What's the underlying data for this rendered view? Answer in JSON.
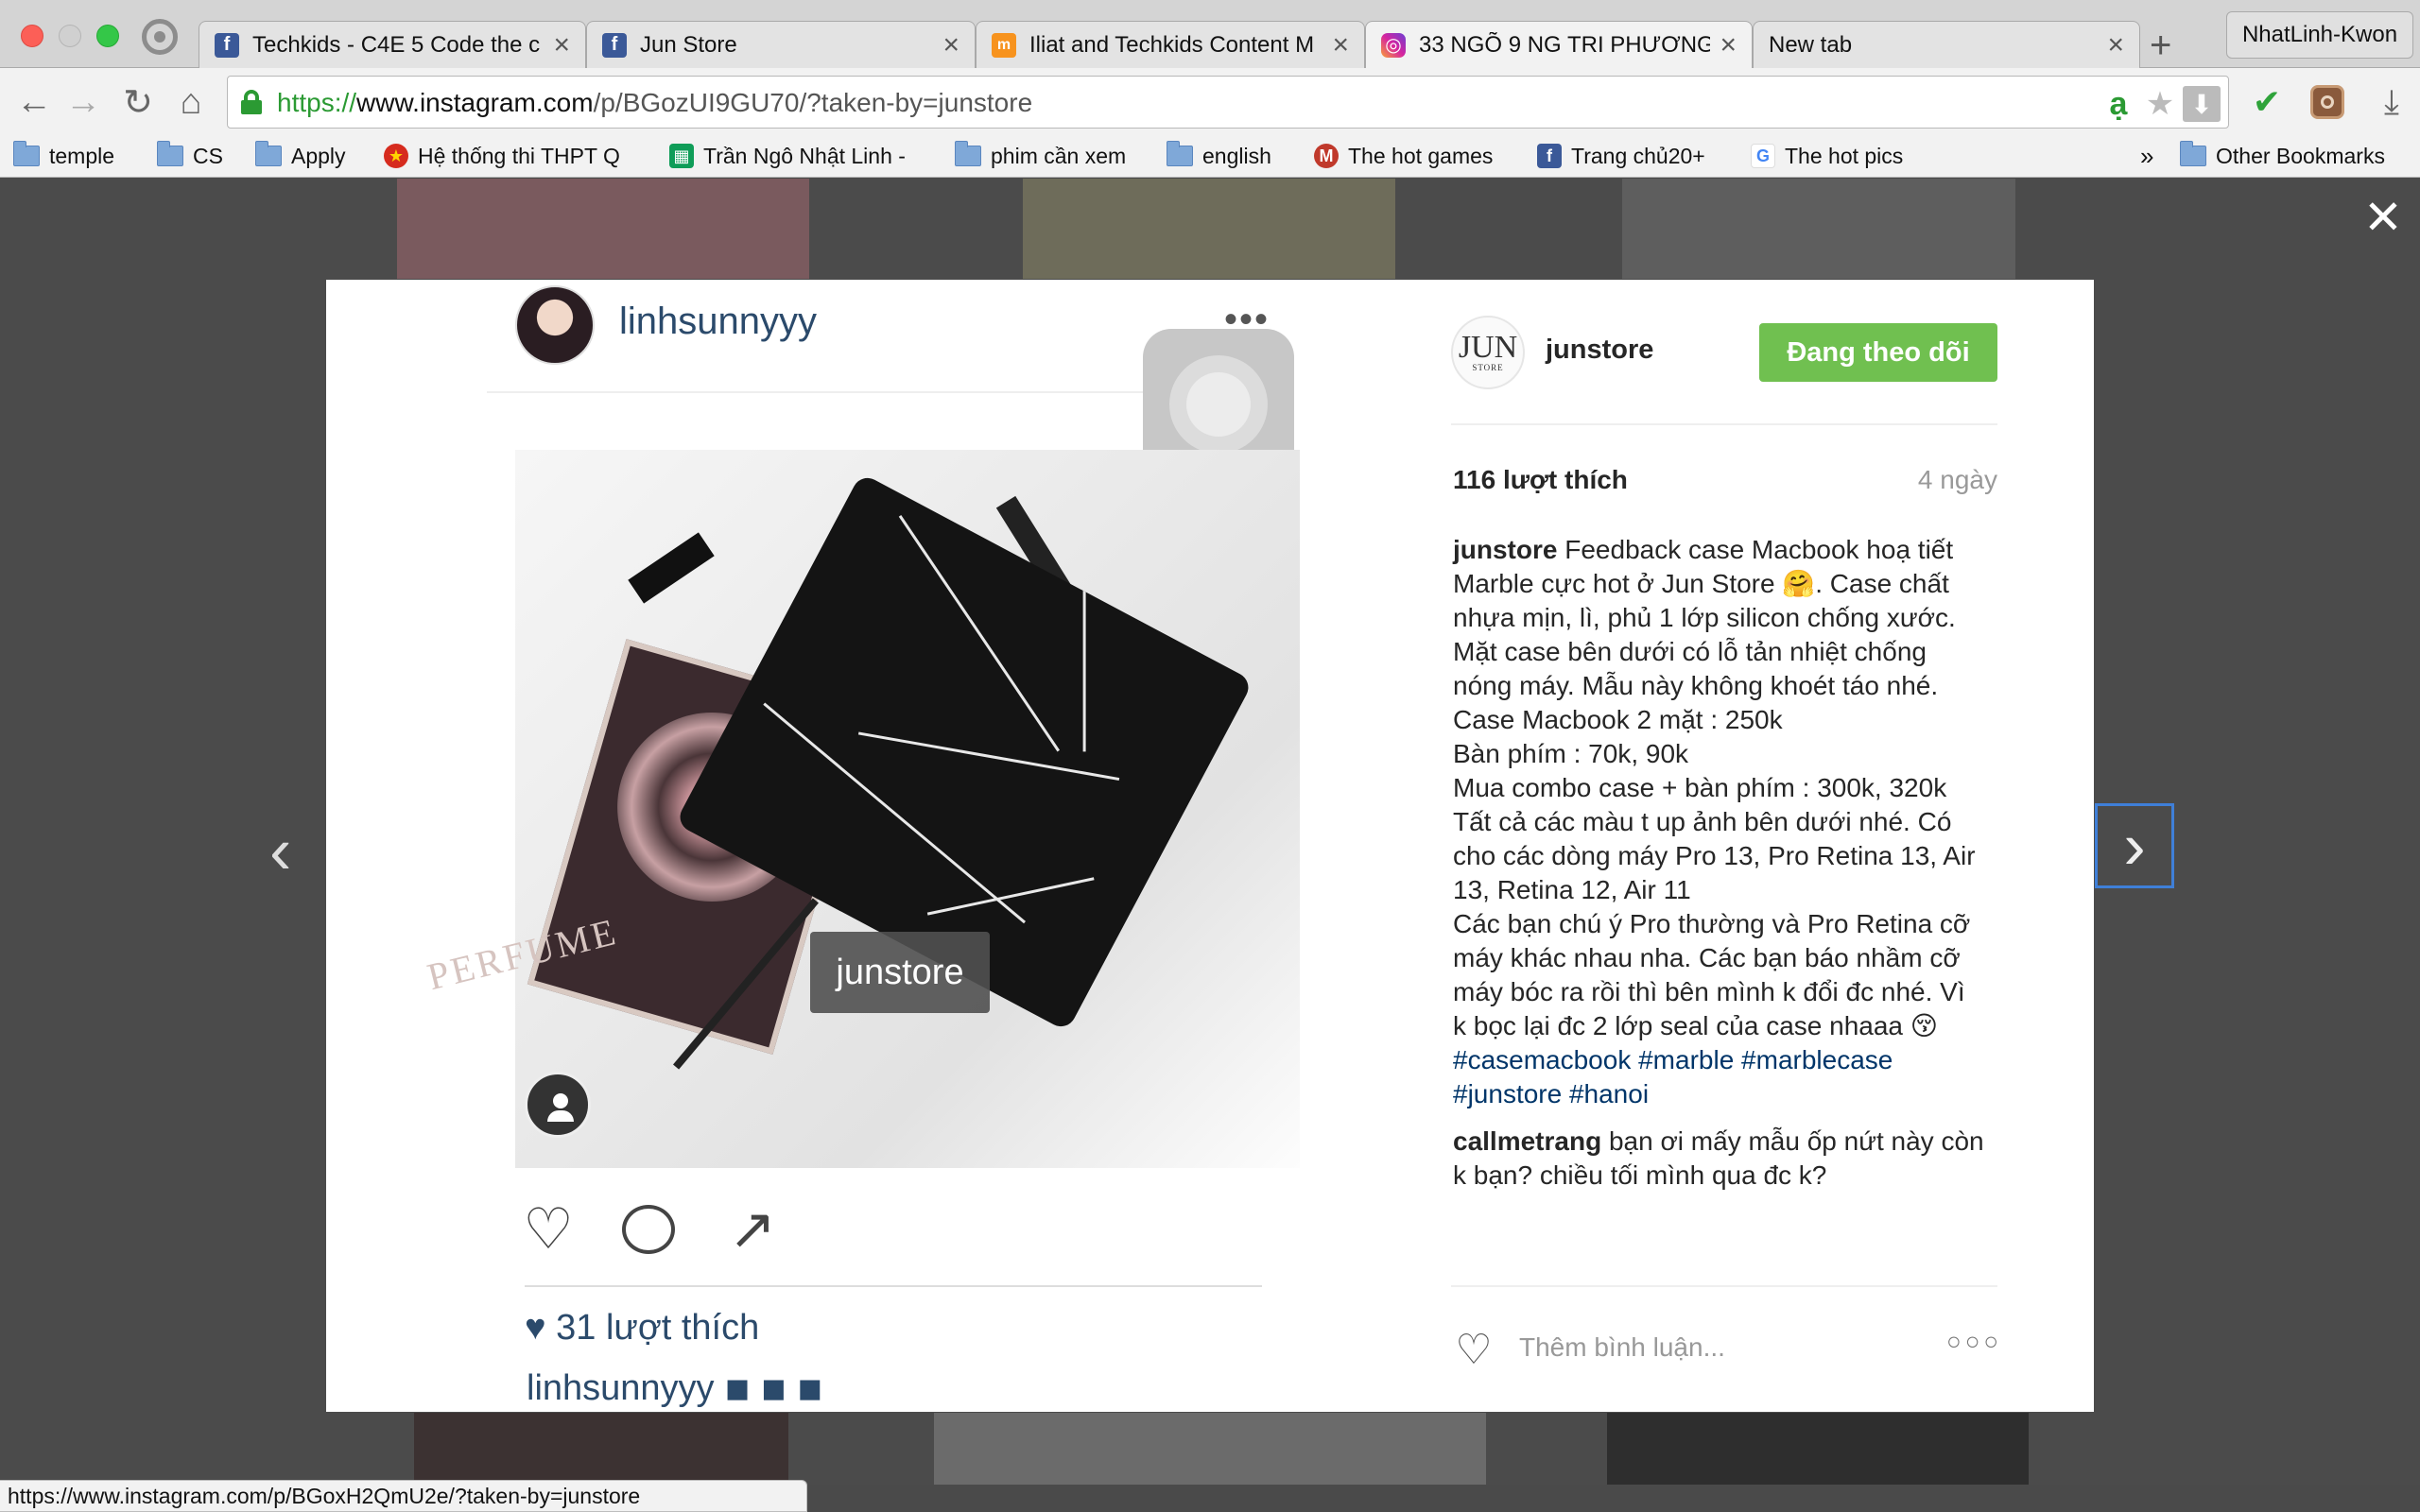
{
  "browser": {
    "tabs": [
      {
        "title": "Techkids - C4E 5 Code the c",
        "favicon": "facebook-icon",
        "active": false
      },
      {
        "title": "Jun Store",
        "favicon": "facebook-icon",
        "active": false
      },
      {
        "title": "Iliat and Techkids Content M",
        "favicon": "moodle-icon",
        "active": false
      },
      {
        "title": "33 NGÕ 9 NG TRI PHƯƠNG,",
        "favicon": "instagram-icon",
        "active": true
      },
      {
        "title": "New tab",
        "favicon": "",
        "active": false
      }
    ],
    "profile_name": "NhatLinh-Kwon",
    "url": {
      "scheme": "https://",
      "host": "www.instagram.com",
      "path": "/p/BGozUI9GU70/?taken-by=junstore"
    },
    "omnibox_icons": [
      "vietnamese-input-icon",
      "star-icon",
      "download-arrow-icon"
    ],
    "extension_icons": [
      "checkmark-icon",
      "instagram-icon",
      "download-icon"
    ],
    "bookmarks": [
      {
        "label": "temple",
        "icon": "folder-icon"
      },
      {
        "label": "CS",
        "icon": "folder-icon"
      },
      {
        "label": "Apply",
        "icon": "folder-icon"
      },
      {
        "label": "Hệ thống thi THPT Q",
        "icon": "emblem-icon"
      },
      {
        "label": "Trần Ngô Nhật Linh -",
        "icon": "sheets-icon"
      },
      {
        "label": "phim cần xem",
        "icon": "folder-icon"
      },
      {
        "label": "english",
        "icon": "folder-icon"
      },
      {
        "label": "The hot games",
        "icon": "game-icon"
      },
      {
        "label": "Trang chủ20+",
        "icon": "facebook-icon"
      },
      {
        "label": "The hot pics",
        "icon": "google-icon"
      }
    ],
    "bookmarks_overflow": "»",
    "other_bookmarks": "Other Bookmarks",
    "status_url": "https://www.instagram.com/p/BGoxH2QmU2e/?taken-by=junstore"
  },
  "post_image": {
    "inner_username": "linhsunnyyy",
    "inner_more": "•••",
    "book_title": "PERFUME",
    "watermark": "junstore",
    "inner_likes": "31 lượt thích",
    "inner_caption_user": "linhsunnyyy",
    "inner_caption_emoji": "◾ ◾ ◾"
  },
  "post": {
    "username": "junstore",
    "avatar_text": "JUN",
    "avatar_subtext": "STORE",
    "follow_label": "Đang theo dõi",
    "likes": "116 lượt thích",
    "age": "4 ngày",
    "caption_user": "junstore",
    "caption_lines": [
      "Feedback case Macbook hoạ tiết",
      "Marble cực hot ở Jun Store 🤗. Case chất",
      "nhựa mịn, lì, phủ 1 lớp silicon chống xước.",
      "Mặt case bên dưới có lỗ tản nhiệt chống",
      "nóng máy. Mẫu này không khoét táo nhé.",
      "Case Macbook 2 mặt : 250k",
      "Bàn phím : 70k, 90k",
      "Mua combo case + bàn phím : 300k, 320k",
      "Tất cả các màu t up ảnh bên dưới nhé. Có",
      "cho các dòng máy Pro 13, Pro Retina 13, Air",
      "13, Retina 12, Air 11",
      "Các bạn chú ý Pro thường và Pro Retina cỡ",
      "máy khác nhau nha. Các bạn báo nhầm cỡ",
      "máy bóc ra rồi thì bên mình k đổi đc nhé. Vì",
      "k bọc lại đc 2 lớp seal của case nhaaa 😚"
    ],
    "hashtags_line1": "#casemacbook #marble #marblecase",
    "hashtags_line2": "#junstore #hanoi",
    "comment_user": "callmetrang",
    "comment_text": "bạn ơi mấy mẫu ốp nứt này còn k bạn? chiều tối mình qua đc k?",
    "add_comment_placeholder": "Thêm bình luận...",
    "more_options": "○○○"
  },
  "overlay": {
    "close": "✕",
    "prev": "‹",
    "next": "›"
  },
  "colors": {
    "follow_button": "#70c050",
    "hashtag": "#003569",
    "overlay_bg": "#4b4b4b"
  }
}
